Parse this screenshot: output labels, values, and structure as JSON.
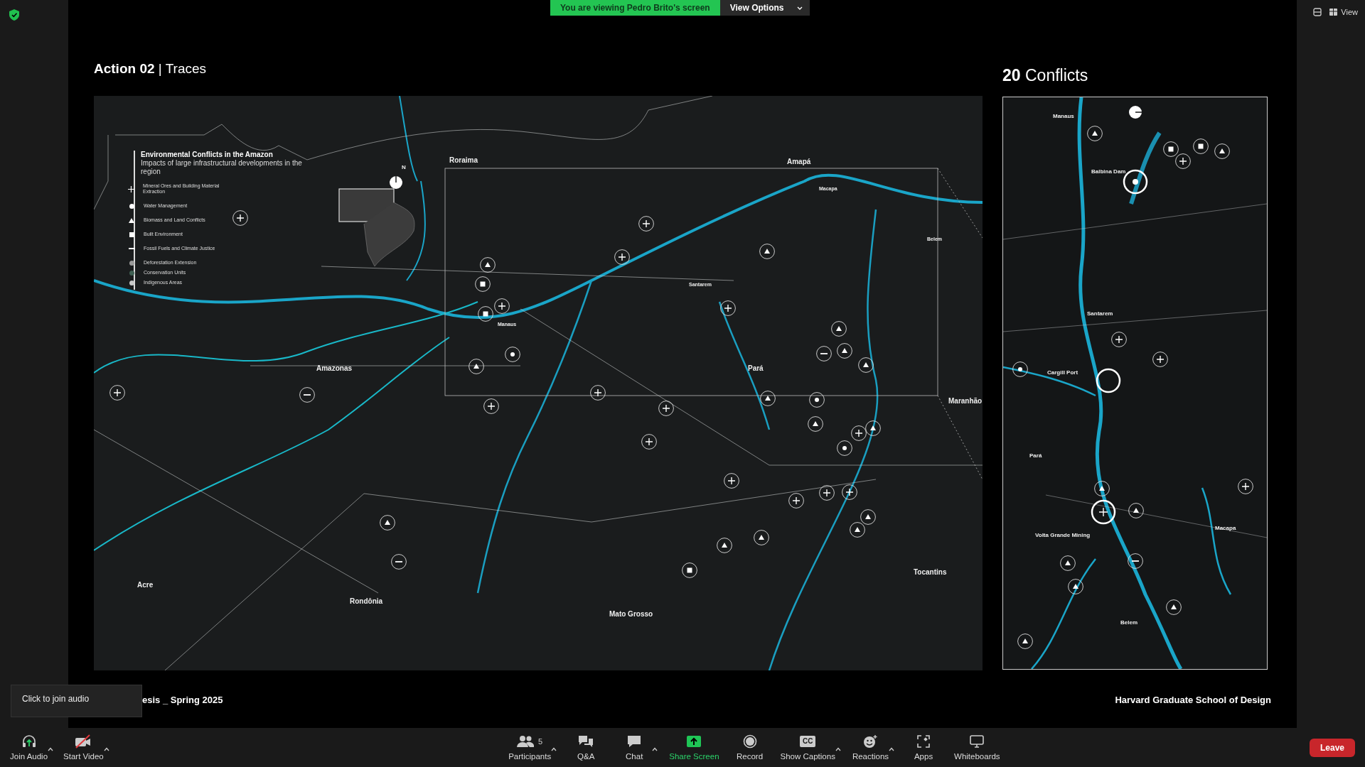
{
  "top_banner": {
    "text": "You are viewing Pedro Brito's screen",
    "view_options": "View Options"
  },
  "top_right": {
    "view": "View"
  },
  "slide": {
    "title": "**Action 02** | Traces",
    "map_labels": [
      "Roraima",
      "Amapá",
      "Macapa",
      "Manaus",
      "Santarem",
      "Belem",
      "Amazonas",
      "Pará",
      "Maranhão",
      "Acre",
      "Rondônia",
      "Mato Grosso",
      "Tocantins"
    ],
    "legend": {
      "title": "Environmental Conflicts in the Amazon",
      "subtitle": "Impacts of large infrastructural developments in the region",
      "items": [
        {
          "kind": "plus",
          "label": "Mineral Ores and Building Material Extraction"
        },
        {
          "kind": "dot",
          "label": "Water Management"
        },
        {
          "kind": "triangle",
          "label": "Biomass and Land Conflicts"
        },
        {
          "kind": "square",
          "label": "Built Environment"
        },
        {
          "kind": "dash",
          "label": "Fossil Fuels and Climate Justice"
        },
        {
          "kind": "area",
          "label": "Deforestation Extension",
          "color": "#9a9a9a"
        },
        {
          "kind": "area",
          "label": "Conservation Units",
          "color": "#3f5f52"
        },
        {
          "kind": "area",
          "label": "Indigenous Areas",
          "color": "#c8c8c8"
        }
      ]
    },
    "north_label": "N",
    "panel_title": "**20** Conflicts",
    "panel_labels": [
      "Manaus",
      "Balbina Dam",
      "Santarem",
      "Cargill Port",
      "Pará",
      "Volta Grande Mining",
      "Macapa",
      "Belem"
    ],
    "footer_left": "esis _ Spring 2025",
    "footer_right": "Harvard Graduate School of Design"
  },
  "tooltip": "Click to join audio",
  "toolbar": [
    {
      "kind": "audio",
      "label": "Join Audio",
      "caret": true
    },
    {
      "kind": "video",
      "label": "Start Video",
      "caret": true,
      "off": true
    },
    {
      "kind": "participants",
      "label": "Participants",
      "caret": true,
      "count": "5"
    },
    {
      "kind": "qa",
      "label": "Q&A",
      "caret": false
    },
    {
      "kind": "chat",
      "label": "Chat",
      "caret": true
    },
    {
      "kind": "share",
      "label": "Share Screen",
      "caret": false
    },
    {
      "kind": "record",
      "label": "Record",
      "caret": false
    },
    {
      "kind": "captions",
      "label": "Show Captions",
      "caret": true,
      "icon_text": "CC"
    },
    {
      "kind": "reactions",
      "label": "Reactions",
      "caret": true
    },
    {
      "kind": "apps",
      "label": "Apps",
      "caret": false
    },
    {
      "kind": "whiteboards",
      "label": "Whiteboards",
      "caret": false
    }
  ],
  "leave": "Leave"
}
